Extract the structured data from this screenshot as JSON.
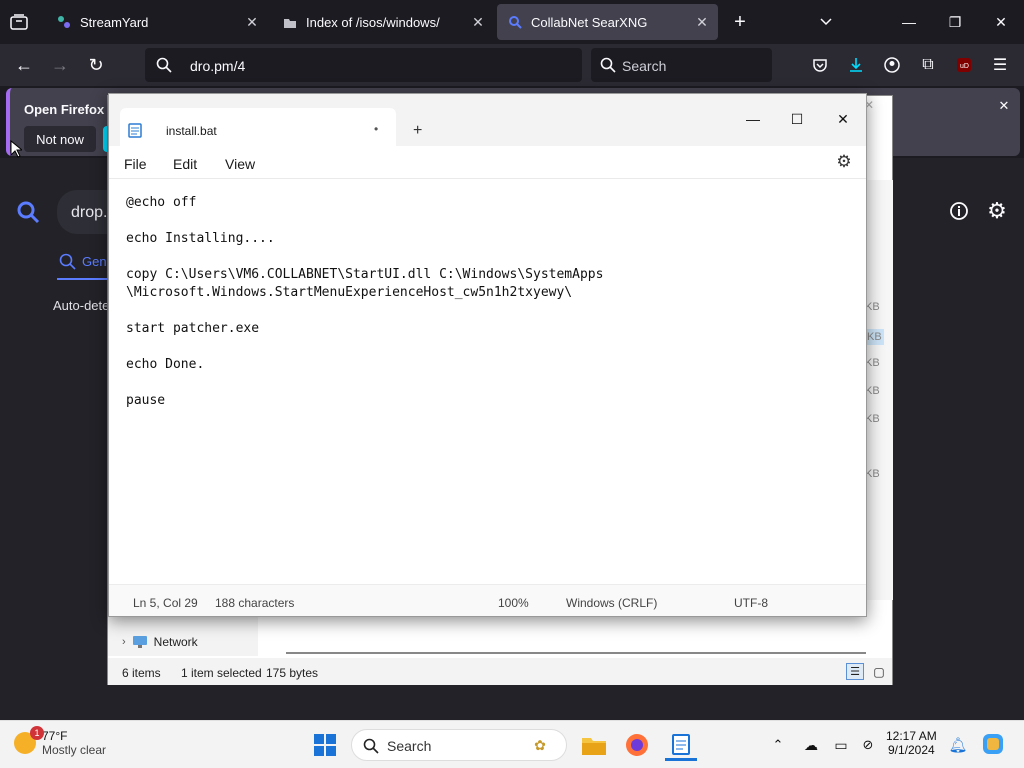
{
  "browser": {
    "tabs": [
      {
        "title": "StreamYard",
        "favicon": "streamyard-icon"
      },
      {
        "title": "Index of /isos/windows/",
        "favicon": "folder-index-icon"
      },
      {
        "title": "CollabNet SearXNG",
        "favicon": "search-icon",
        "active": true
      }
    ],
    "url": "dro.pm/4",
    "search_placeholder": "Search",
    "accent": "#00ddff"
  },
  "notification": {
    "title": "Open Firefox ev",
    "not_now": "Not now"
  },
  "searxng": {
    "query": "drop.",
    "category": "Gene",
    "auto_detect": "Auto-dete"
  },
  "notepad": {
    "tab_title": "install.bat",
    "unsaved_dot": "•",
    "menu": [
      "File",
      "Edit",
      "View"
    ],
    "content": "@echo off\n\necho Installing....\n\ncopy C:\\Users\\VM6.COLLABNET\\StartUI.dll C:\\Windows\\SystemApps\n\\Microsoft.Windows.StartMenuExperienceHost_cw5n1h2txyewy\\\n\nstart patcher.exe\n\necho Done.\n\npause",
    "status": {
      "position": "Ln 5, Col 29",
      "chars": "188 characters",
      "zoom": "100%",
      "line_ending": "Windows (CRLF)",
      "encoding": "UTF-8"
    }
  },
  "explorer": {
    "sizes": [
      "KB",
      "KB",
      "KB",
      "KB",
      "KB",
      "KB"
    ],
    "network": "Network",
    "status_items": "6 items",
    "status_selected": "1 item selected",
    "status_bytes": "175 bytes"
  },
  "taskbar": {
    "weather_temp": "77°F",
    "weather_desc": "Mostly clear",
    "weather_badge": "1",
    "search_label": "Search",
    "time": "12:17 AM",
    "date": "9/1/2024"
  }
}
